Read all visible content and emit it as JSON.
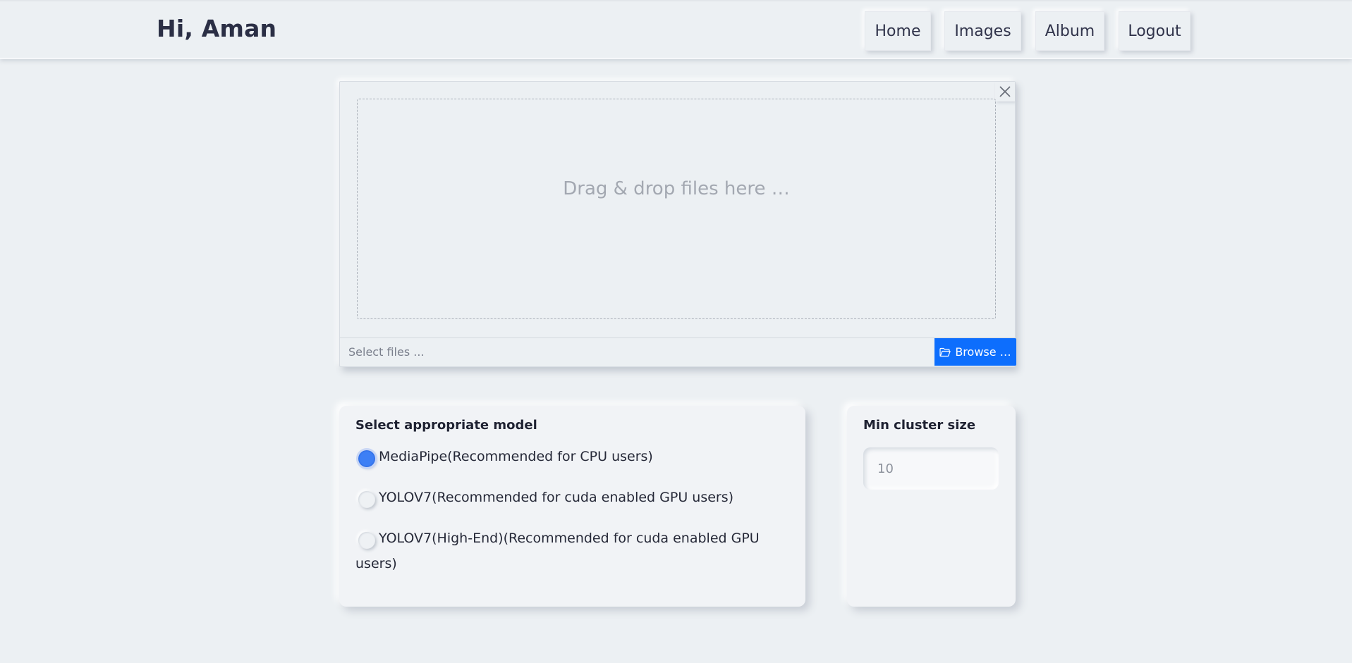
{
  "header": {
    "greeting": "Hi, Aman",
    "nav": {
      "home": "Home",
      "images": "Images",
      "album": "Album",
      "logout": "Logout"
    }
  },
  "upload": {
    "drop_text": "Drag & drop files here …",
    "file_placeholder": "Select files ...",
    "browse_label": "Browse …",
    "browse_icon": "folder-open-icon",
    "close_icon": "close-icon",
    "accent_color": "#0d6efd"
  },
  "model": {
    "title": "Select appropriate model",
    "selected": "MediaPipe",
    "options": [
      {
        "label": "MediaPipe(Recommended for CPU users)",
        "checked": true
      },
      {
        "label": "YOLOV7(Recommended for cuda enabled GPU users)",
        "checked": false
      },
      {
        "label": "YOLOV7(High-End)(Recommended for cuda enabled GPU users)",
        "checked": false
      }
    ]
  },
  "cluster": {
    "title": "Min cluster size",
    "placeholder": "10"
  }
}
